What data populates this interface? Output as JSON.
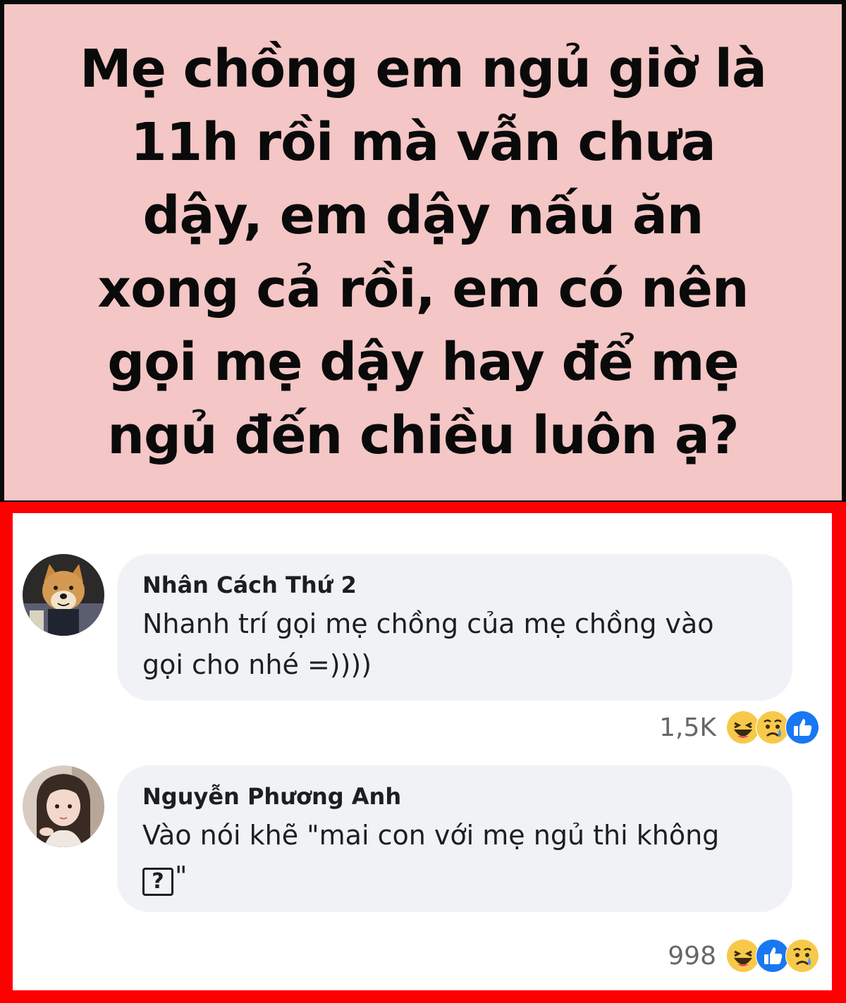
{
  "question": {
    "lines": [
      "Mẹ chồng em ngủ giờ là",
      "11h rồi mà vẫn chưa",
      "dậy, em dậy nấu ăn",
      "xong cả rồi, em có nên",
      "gọi mẹ dậy hay để mẹ",
      "ngủ đến chiều luôn ạ?"
    ]
  },
  "comments": [
    {
      "author": "Nhân Cách Thứ 2",
      "text_line_1": "Nhanh trí gọi mẹ chồng của mẹ chồng vào",
      "text_line_2": "gọi cho nhé =))))",
      "reaction_count": "1,5K",
      "reactions": [
        "haha-icon",
        "sad-icon",
        "like-icon"
      ]
    },
    {
      "author": "Nguyễn Phương Anh",
      "text_line_1": "Vào nói khẽ \"mai con với mẹ ngủ thi không",
      "text_box_glyph": "?",
      "text_line_2_suffix": "\"",
      "reaction_count": "998",
      "reactions": [
        "haha-icon",
        "like-icon",
        "sad-icon"
      ]
    }
  ],
  "colors": {
    "question_bg": "#f4c6c6",
    "border_red": "#ff0000",
    "bubble_bg": "#f0f2f5",
    "like_blue": "#1877f2",
    "reaction_yellow": "#f7c94a",
    "count_gray": "#65676b"
  }
}
